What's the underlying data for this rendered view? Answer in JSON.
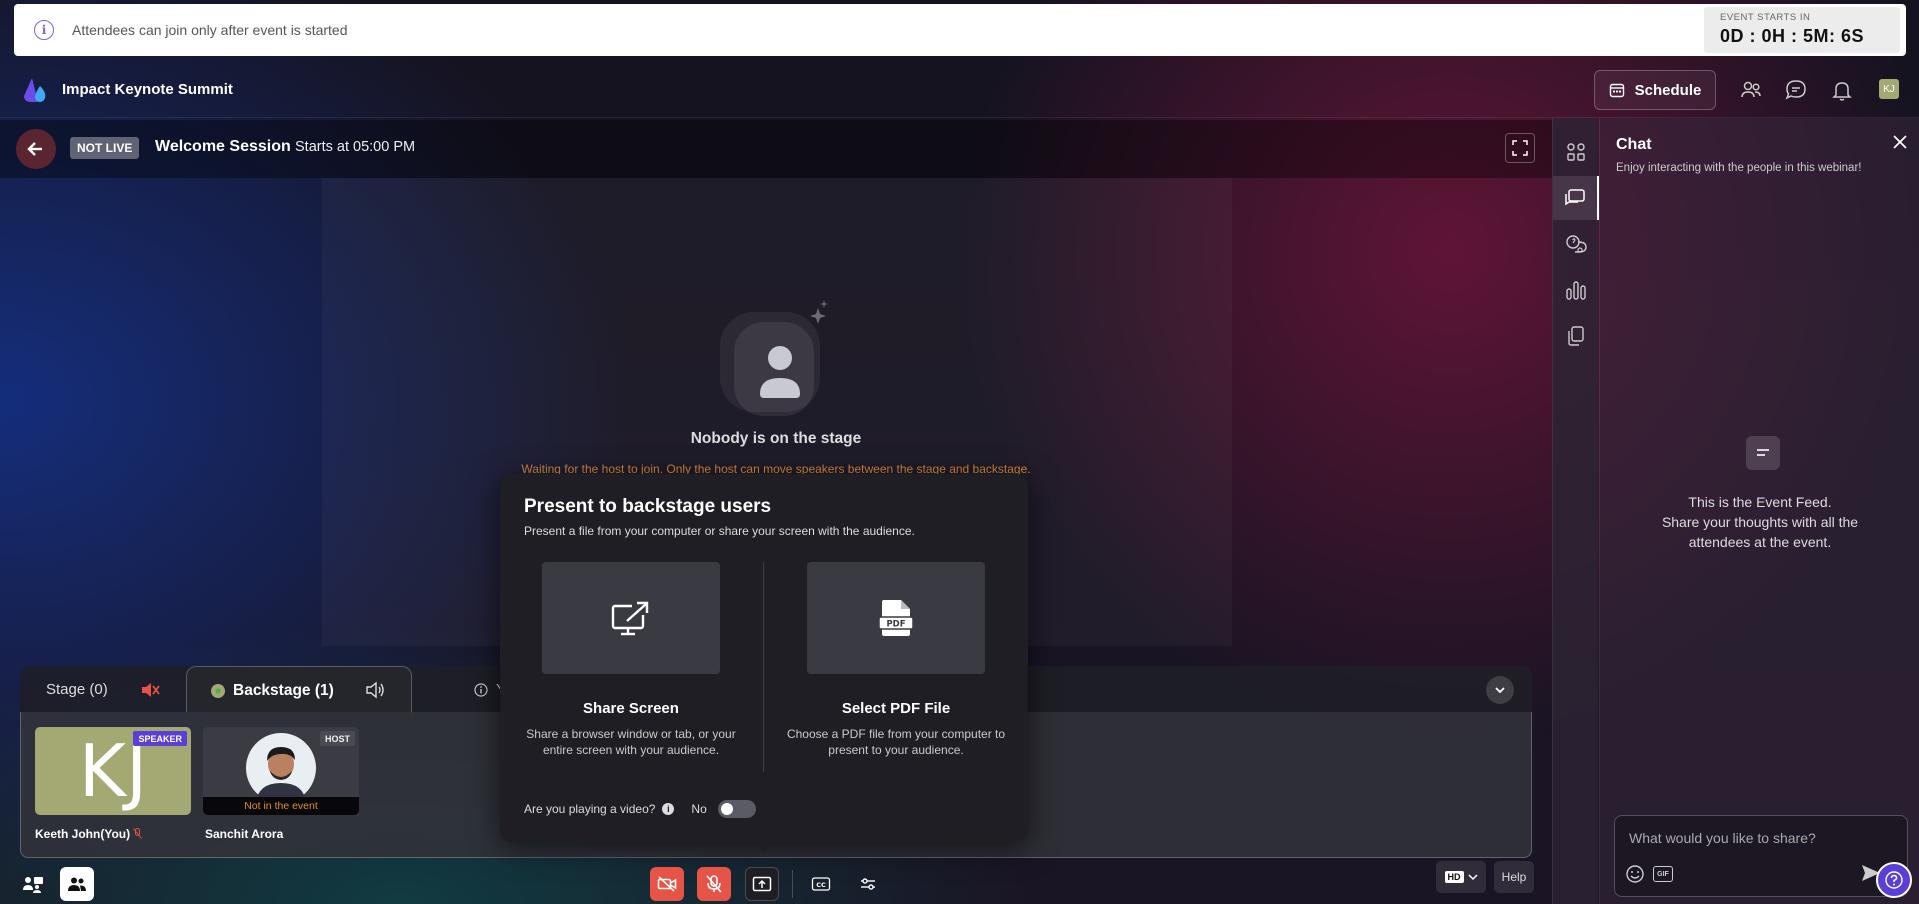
{
  "notice": {
    "message": "Attendees can join only after event is started",
    "timer_label": "EVENT STARTS IN",
    "timer_value": "0D : 0H : 5M: 6S"
  },
  "header": {
    "event_title": "Impact Keynote Summit",
    "schedule_label": "Schedule",
    "avatar_initials": "KJ"
  },
  "session": {
    "status_badge": "NOT LIVE",
    "title": "Welcome Session",
    "start_time": "Starts at 05:00 PM"
  },
  "stage": {
    "empty_title": "Nobody is on the stage",
    "empty_message": "Waiting for the host to join. Only the host can move speakers between the stage and backstage."
  },
  "tabs": {
    "stage_label": "Stage (0)",
    "backstage_label": "Backstage (1)",
    "info_label": "Y"
  },
  "participants": [
    {
      "initials": "KJ",
      "badge": "SPEAKER",
      "name": "Keeth John(You)"
    },
    {
      "badge": "HOST",
      "status": "Not in the event",
      "name": "Sanchit Arora"
    }
  ],
  "present_popup": {
    "title": "Present to backstage users",
    "subtitle": "Present a file from your computer or share your screen with the audience.",
    "options": [
      {
        "title": "Share Screen",
        "description": "Share a browser window or tab, or your entire screen with your audience."
      },
      {
        "title": "Select PDF File",
        "description": "Choose a PDF file from your computer to present to your audience."
      }
    ],
    "video_question": "Are you playing a video?",
    "video_toggle_value": "No"
  },
  "toolbar": {
    "quality_label": "HD",
    "help_label": "Help",
    "cc_label": "CC"
  },
  "chat": {
    "title": "Chat",
    "subtitle": "Enjoy interacting with the people in this webinar!",
    "empty_line1": "This is the Event Feed.",
    "empty_line2": "Share your thoughts with all the",
    "empty_line3": "attendees at the event.",
    "input_placeholder": "What would you like to share?",
    "gif_label": "GIF"
  },
  "colors": {
    "accent": "#5b3ed6",
    "danger": "#e55446",
    "warning_text": "#d8893a"
  }
}
